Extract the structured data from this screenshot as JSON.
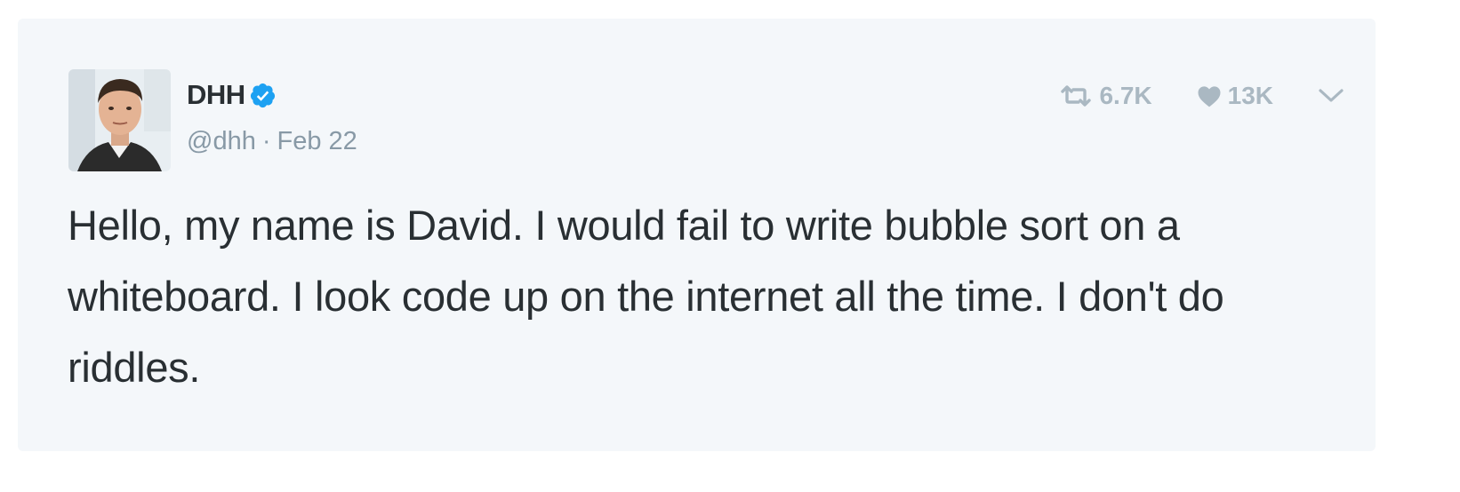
{
  "tweet": {
    "display_name": "DHH",
    "handle": "@dhh",
    "separator": "·",
    "date": "Feb 22",
    "text": "Hello, my name is David. I would fail to write bubble sort on a whiteboard. I look code up on the internet all the time. I don't do riddles.",
    "verified": true,
    "retweet_count": "6.7K",
    "like_count": "13K"
  },
  "icons": {
    "verified": "verified-badge-icon",
    "retweet": "retweet-icon",
    "like": "heart-icon",
    "more": "chevron-down-icon"
  },
  "colors": {
    "card_background": "#f4f7fa",
    "text": "#292f33",
    "muted": "#8899a6",
    "action": "#aab8c2",
    "verified_blue": "#1da1f2"
  }
}
